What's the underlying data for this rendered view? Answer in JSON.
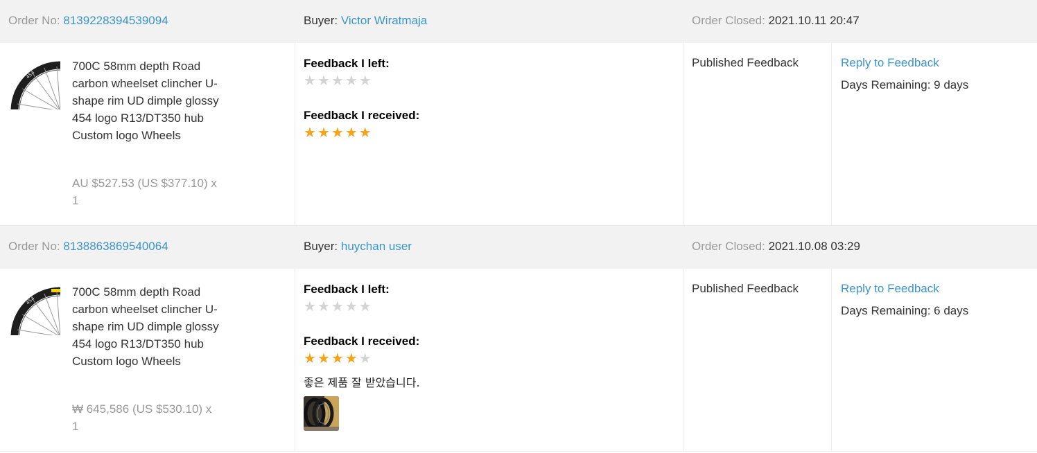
{
  "labels": {
    "order_no": "Order No:",
    "buyer": "Buyer:",
    "order_closed": "Order Closed:",
    "feedback_left": "Feedback I left:",
    "feedback_received": "Feedback I received:"
  },
  "colors": {
    "link": "#3b95c8",
    "star_on": "#f5a31a",
    "star_off": "#d4d4d4",
    "header_bg": "#f2f2f2"
  },
  "orders": [
    {
      "order_no": "8139228394539094",
      "buyer": "Victor Wiratmaja",
      "closed": "2021.10.11 20:47",
      "product": {
        "title": "700C 58mm depth Road carbon wheelset clincher U-shape rim UD dimple glossy 454 logo R13/DT350 hub Custom logo Wheels",
        "image_icon": "carbon-wheel-thumbnail",
        "price": "AU $527.53 (US $377.10) x 1"
      },
      "feedback_left_rating": 0,
      "feedback_received_rating": 5,
      "comment": "",
      "status": "Published Feedback",
      "reply_link": "Reply to Feedback",
      "days_remaining": "Days Remaining: 9 days"
    },
    {
      "order_no": "8138863869540064",
      "buyer": "huychan user",
      "closed": "2021.10.08 03:29",
      "product": {
        "title": "700C 58mm depth Road carbon wheelset clincher U-shape rim UD dimple glossy 454 logo R13/DT350 hub Custom logo Wheels",
        "image_icon": "carbon-wheel-thumbnail",
        "price": "₩ 645,586 (US $530.10) x 1"
      },
      "feedback_left_rating": 0,
      "feedback_received_rating": 4,
      "comment": "좋은 제품 잘 받았습니다.",
      "has_photo": true,
      "status": "Published Feedback",
      "reply_link": "Reply to Feedback",
      "days_remaining": "Days Remaining: 6 days"
    }
  ]
}
